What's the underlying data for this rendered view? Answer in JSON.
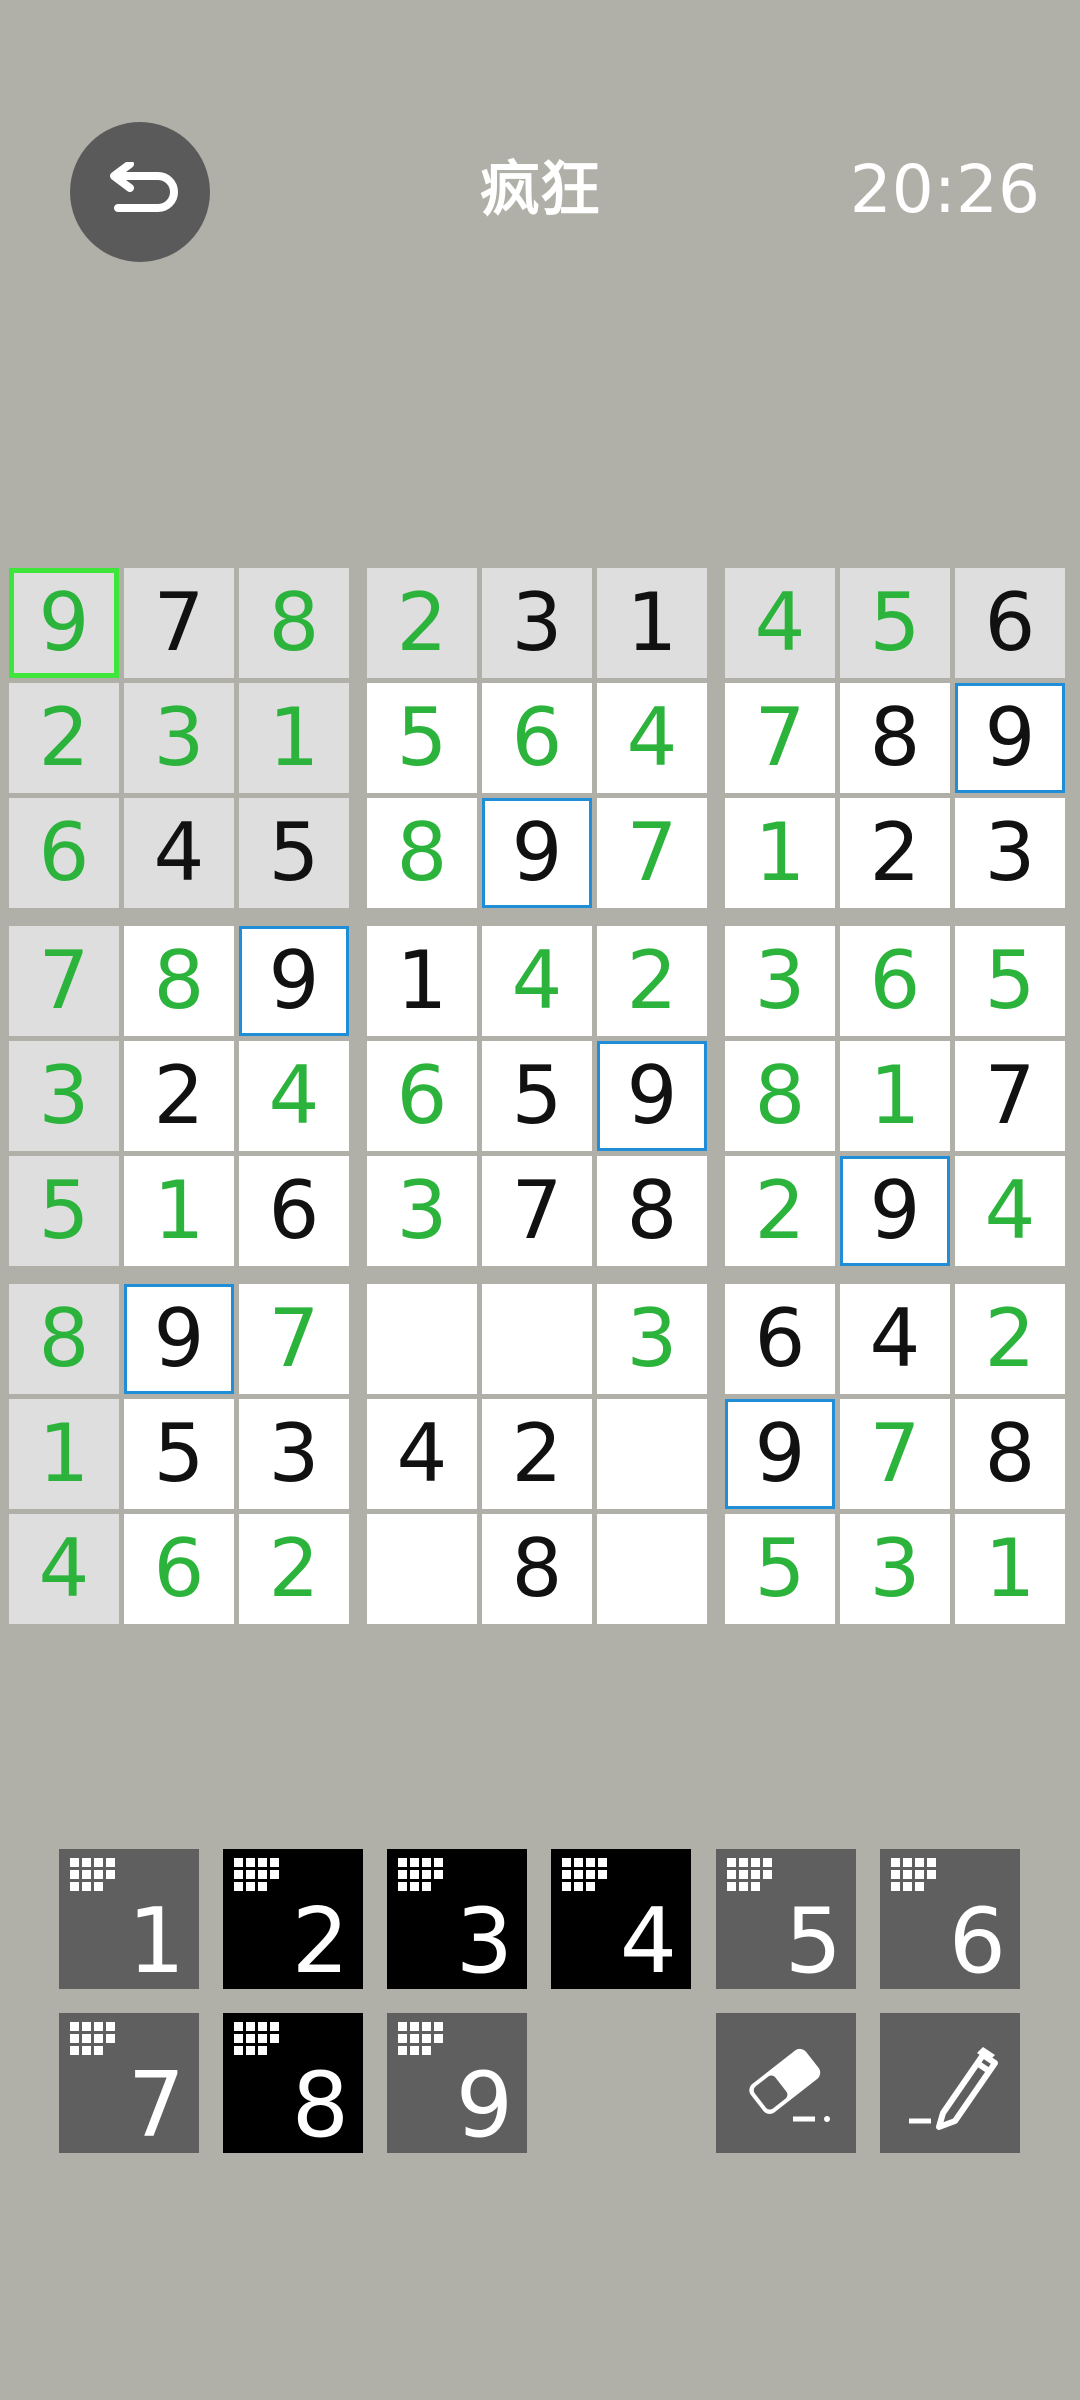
{
  "header": {
    "back_icon": "undo-arrow-icon",
    "difficulty": "疯狂",
    "timer": "20:26"
  },
  "colors": {
    "background": "#b1b0a8",
    "given_cell": "#dedede",
    "open_cell": "#ffffff",
    "green_digit": "#2bb33b",
    "black_digit": "#111111",
    "highlight_outline": "#1f8ed6",
    "selected_outline": "#3ee63b",
    "key_active": "#5f5f5f",
    "key_completed": "#000000"
  },
  "board": {
    "rows": [
      [
        "9",
        "7",
        "8",
        "2",
        "3",
        "1",
        "4",
        "5",
        "6"
      ],
      [
        "2",
        "3",
        "1",
        "5",
        "6",
        "4",
        "7",
        "8",
        "9"
      ],
      [
        "6",
        "4",
        "5",
        "8",
        "9",
        "7",
        "1",
        "2",
        "3"
      ],
      [
        "7",
        "8",
        "9",
        "1",
        "4",
        "2",
        "3",
        "6",
        "5"
      ],
      [
        "3",
        "2",
        "4",
        "6",
        "5",
        "9",
        "8",
        "1",
        "7"
      ],
      [
        "5",
        "1",
        "6",
        "3",
        "7",
        "8",
        "2",
        "9",
        "4"
      ],
      [
        "8",
        "9",
        "7",
        "",
        "",
        "3",
        "6",
        "4",
        "2"
      ],
      [
        "1",
        "5",
        "3",
        "4",
        "2",
        "",
        "9",
        "7",
        "8"
      ],
      [
        "4",
        "6",
        "2",
        "",
        "8",
        "",
        "5",
        "3",
        "1"
      ]
    ],
    "given_cells": [
      [
        0,
        0
      ],
      [
        0,
        1
      ],
      [
        0,
        2
      ],
      [
        0,
        3
      ],
      [
        0,
        4
      ],
      [
        0,
        5
      ],
      [
        0,
        6
      ],
      [
        0,
        7
      ],
      [
        0,
        8
      ],
      [
        1,
        0
      ],
      [
        1,
        1
      ],
      [
        1,
        2
      ],
      [
        2,
        0
      ],
      [
        2,
        1
      ],
      [
        2,
        2
      ],
      [
        3,
        0
      ],
      [
        4,
        0
      ],
      [
        5,
        0
      ],
      [
        6,
        0
      ],
      [
        7,
        0
      ],
      [
        8,
        0
      ]
    ],
    "green_cells": [
      [
        0,
        0
      ],
      [
        0,
        2
      ],
      [
        0,
        3
      ],
      [
        0,
        6
      ],
      [
        0,
        7
      ],
      [
        1,
        0
      ],
      [
        1,
        1
      ],
      [
        1,
        2
      ],
      [
        1,
        3
      ],
      [
        1,
        4
      ],
      [
        1,
        5
      ],
      [
        1,
        6
      ],
      [
        2,
        0
      ],
      [
        2,
        3
      ],
      [
        2,
        5
      ],
      [
        2,
        6
      ],
      [
        3,
        0
      ],
      [
        3,
        1
      ],
      [
        3,
        4
      ],
      [
        3,
        5
      ],
      [
        3,
        6
      ],
      [
        3,
        7
      ],
      [
        3,
        8
      ],
      [
        4,
        0
      ],
      [
        4,
        2
      ],
      [
        4,
        3
      ],
      [
        4,
        6
      ],
      [
        4,
        7
      ],
      [
        5,
        0
      ],
      [
        5,
        1
      ],
      [
        5,
        3
      ],
      [
        5,
        6
      ],
      [
        5,
        8
      ],
      [
        6,
        0
      ],
      [
        6,
        2
      ],
      [
        6,
        5
      ],
      [
        6,
        8
      ],
      [
        7,
        0
      ],
      [
        7,
        7
      ],
      [
        8,
        0
      ],
      [
        8,
        1
      ],
      [
        8,
        2
      ],
      [
        8,
        6
      ],
      [
        8,
        7
      ],
      [
        8,
        8
      ]
    ],
    "highlighted_cells": [
      [
        1,
        8
      ],
      [
        2,
        4
      ],
      [
        3,
        2
      ],
      [
        4,
        5
      ],
      [
        5,
        7
      ],
      [
        6,
        1
      ],
      [
        7,
        6
      ]
    ],
    "selected_cell": [
      0,
      0
    ]
  },
  "keypad": {
    "keys": [
      {
        "label": "1",
        "completed": false
      },
      {
        "label": "2",
        "completed": true
      },
      {
        "label": "3",
        "completed": true
      },
      {
        "label": "4",
        "completed": true
      },
      {
        "label": "5",
        "completed": false
      },
      {
        "label": "6",
        "completed": false
      },
      {
        "label": "7",
        "completed": false
      },
      {
        "label": "8",
        "completed": true
      },
      {
        "label": "9",
        "completed": false
      }
    ],
    "eraser_icon": "eraser-icon",
    "pencil_icon": "pencil-note-icon"
  }
}
